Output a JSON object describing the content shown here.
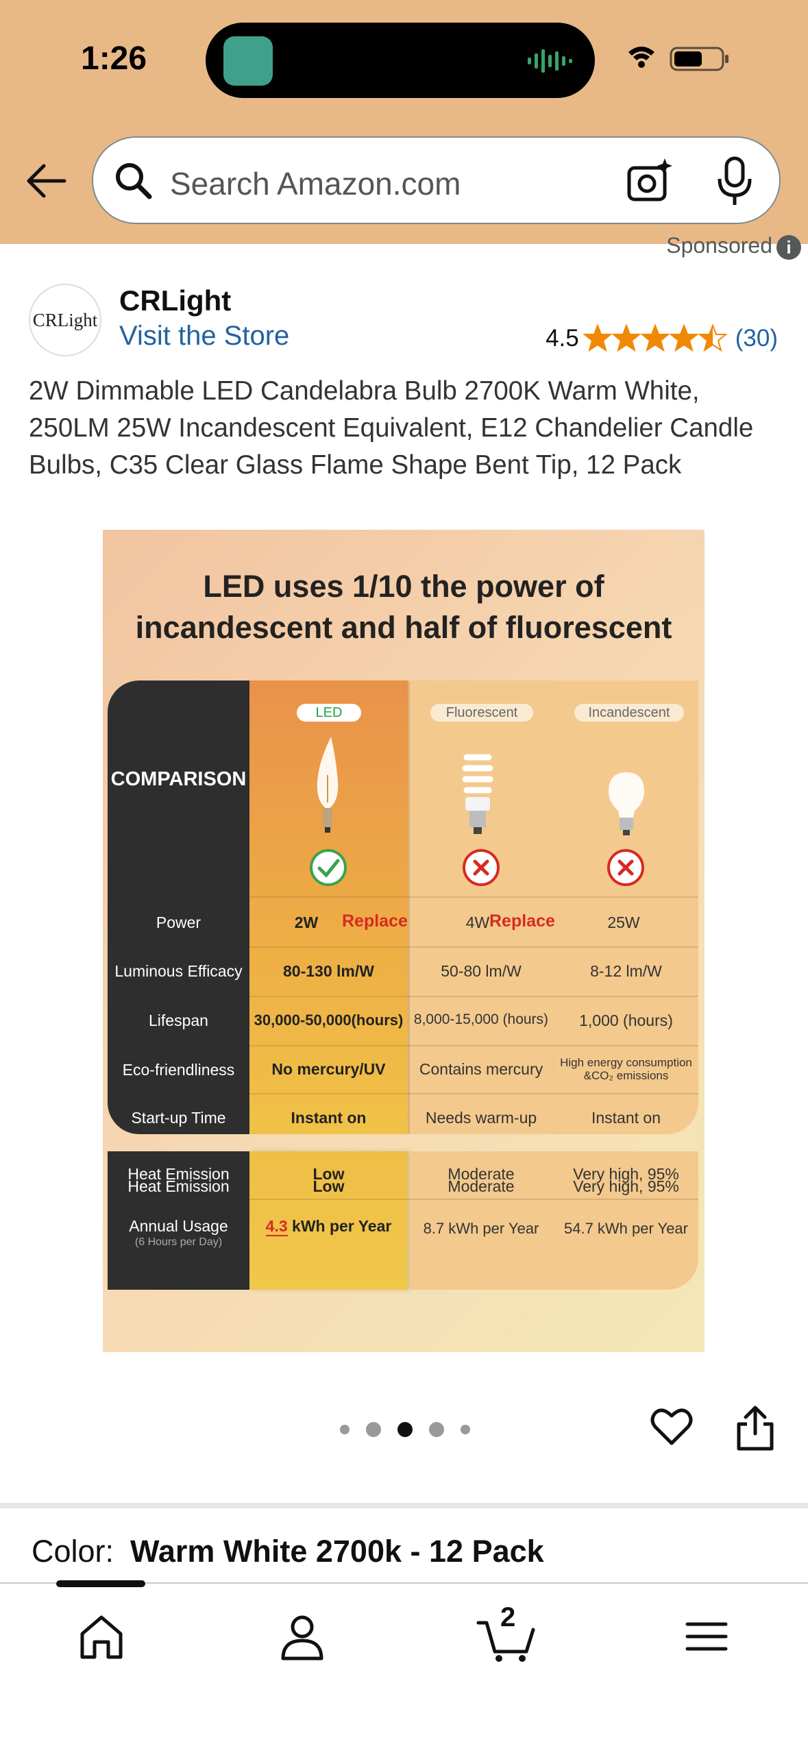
{
  "status": {
    "time": "1:26"
  },
  "search": {
    "placeholder": "Search Amazon.com"
  },
  "sponsored": {
    "label": "Sponsored"
  },
  "store": {
    "logo_text": "CRLight",
    "brand": "CRLight",
    "visit_label": "Visit the Store",
    "rating": "4.5",
    "rating_value": 4.5,
    "review_count": "(30)"
  },
  "product": {
    "title": "2W Dimmable LED Candelabra Bulb 2700K Warm White, 250LM 25W Incandescent Equivalent, E12 Chandelier Candle Bulbs, C35 Clear Glass Flame Shape Bent Tip, 12 Pack"
  },
  "image": {
    "headline_1": "LED uses 1/10 the power of",
    "headline_2": "incandescent and half of fluorescent",
    "comparison_label": "COMPARISON",
    "columns": [
      "LED",
      "Fluorescent",
      "Incandescent"
    ],
    "replace_label": "Replace",
    "rows": [
      {
        "label": "Power",
        "led": "2W",
        "fluorescent": "4W",
        "incandescent": "25W"
      },
      {
        "label": "Luminous Efficacy",
        "led": "80-130 lm/W",
        "fluorescent": "50-80 lm/W",
        "incandescent": "8-12 lm/W"
      },
      {
        "label": "Lifespan",
        "led": "30,000-50,000(hours)",
        "fluorescent": "8,000-15,000 (hours)",
        "incandescent": "1,000 (hours)"
      },
      {
        "label": "Eco-friendliness",
        "led": "No mercury/UV",
        "fluorescent": "Contains mercury",
        "incandescent": "High energy consumption &CO₂ emissions"
      },
      {
        "label": "Start-up Time",
        "led": "Instant on",
        "fluorescent": "Needs warm-up",
        "incandescent": "Instant on"
      },
      {
        "label": "Heat Emission",
        "led": "Low",
        "fluorescent": "Moderate",
        "incandescent": "Very high, 95%"
      }
    ],
    "annual": {
      "label": "Annual Usage",
      "sublabel": "(6 Hours per Day)",
      "led_value": "4.3",
      "led_unit": "kWh per Year",
      "fluorescent": "8.7 kWh per Year",
      "incandescent": "54.7 kWh per Year"
    }
  },
  "carousel": {
    "count": 5,
    "active_index": 2
  },
  "variation": {
    "label": "Color:",
    "value": "Warm White 2700k - 12 Pack"
  },
  "tabbar": {
    "cart_count": "2"
  },
  "colors": {
    "header_bg": "#e8b987",
    "link": "#2162a1",
    "star": "#f08804",
    "accent_red": "#d62b22"
  }
}
